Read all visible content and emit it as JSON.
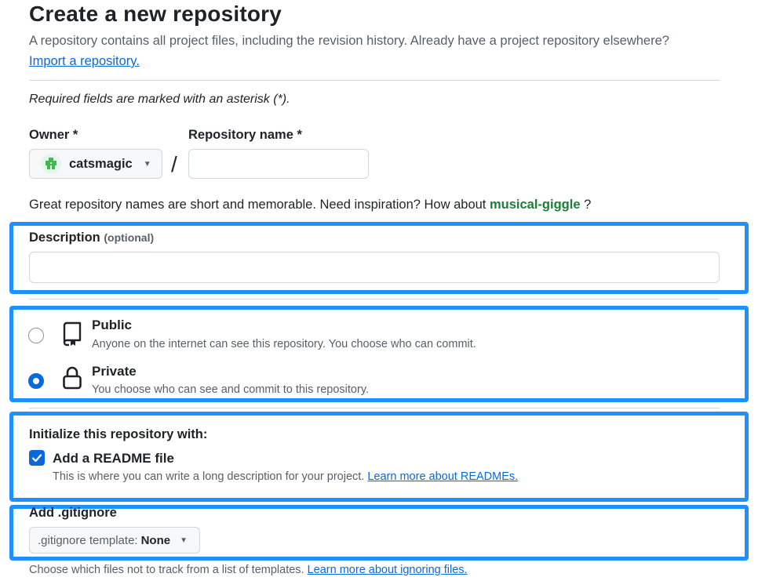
{
  "page": {
    "title": "Create a new repository",
    "intro": "A repository contains all project files, including the revision history. Already have a project repository elsewhere?",
    "import_link": "Import a repository.",
    "required_note": "Required fields are marked with an asterisk (*)."
  },
  "owner": {
    "label": "Owner *",
    "value": "catsmagic",
    "separator": "/"
  },
  "repo_name": {
    "label": "Repository name *",
    "value": "",
    "placeholder": ""
  },
  "name_hint": {
    "text": "Great repository names are short and memorable. Need inspiration? How about",
    "suggestion": "musical-giggle",
    "suffix": "?"
  },
  "description": {
    "label": "Description",
    "optional": "(optional)",
    "value": "",
    "placeholder": ""
  },
  "visibility": {
    "public": {
      "title": "Public",
      "desc": "Anyone on the internet can see this repository. You choose who can commit.",
      "selected": false,
      "icon": "repo-icon"
    },
    "private": {
      "title": "Private",
      "desc": "You choose who can see and commit to this repository.",
      "selected": true,
      "icon": "lock-icon"
    }
  },
  "initialize": {
    "heading": "Initialize this repository with:",
    "readme_label": "Add a README file",
    "readme_checked": true,
    "readme_desc": "This is where you can write a long description for your project.",
    "readme_link": "Learn more about READMEs."
  },
  "gitignore": {
    "label": "Add .gitignore",
    "select_prefix": ".gitignore template:",
    "select_value": "None",
    "help": "Choose which files not to track from a list of templates.",
    "help_link": "Learn more about ignoring files."
  },
  "colors": {
    "accent": "#0969da",
    "highlight": "#1e90ff",
    "suggestion": "#1a7f37"
  }
}
